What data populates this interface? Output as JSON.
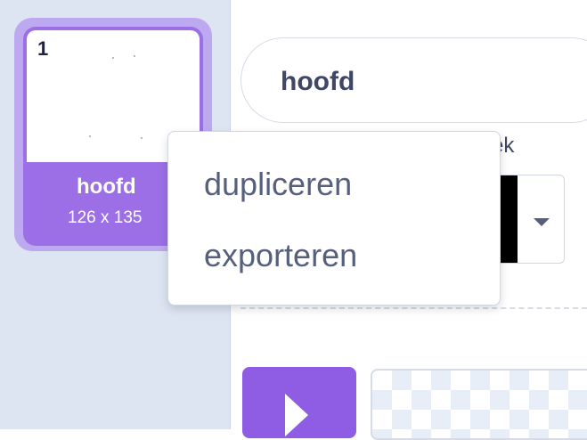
{
  "costume_list": {
    "items": [
      {
        "number": "1",
        "name": "hoofd",
        "size": "126 x 135",
        "selected": true
      }
    ]
  },
  "costume_editor": {
    "name_value": "hoofd",
    "fill_label_partial": "ek",
    "fill_color": "#000000"
  },
  "context_menu": {
    "items": [
      "dupliceren",
      "exporteren"
    ]
  },
  "colors": {
    "accent": "#9c6fe6",
    "selected_border": "#bda9ef",
    "sidebar_bg": "#dde5f3",
    "text": "#56607c"
  },
  "icons": {
    "tool": "play-arrow-icon",
    "dropdown": "caret-down-icon"
  }
}
